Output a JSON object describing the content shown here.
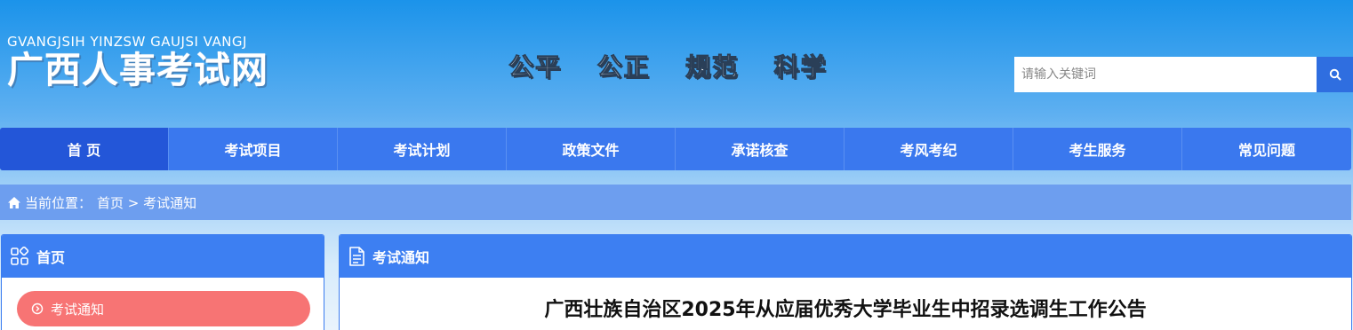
{
  "header": {
    "logo_pinyin": "GVANGJSIH YINZSW GAUJSI VANGJ",
    "logo_cn": "广西人事考试网",
    "slogan": "公平  公正  规范  科学",
    "search": {
      "placeholder": "请输入关键词",
      "button_icon": "search-icon"
    }
  },
  "nav": {
    "items": [
      {
        "label": "首 页",
        "active": true
      },
      {
        "label": "考试项目"
      },
      {
        "label": "考试计划"
      },
      {
        "label": "政策文件"
      },
      {
        "label": "承诺核查"
      },
      {
        "label": "考风考纪"
      },
      {
        "label": "考生服务"
      },
      {
        "label": "常见问题"
      }
    ]
  },
  "breadcrumb": {
    "icon": "home-icon",
    "prefix": "当前位置：",
    "path": "首页 > 考试通知"
  },
  "sidebar": {
    "title": "首页",
    "title_icon": "grid-icon",
    "items": [
      {
        "label": "考试通知",
        "icon": "circle-chevron-icon",
        "active": true
      }
    ]
  },
  "main": {
    "section_title": "考试通知",
    "section_icon": "document-icon",
    "article_title": "广西壮族自治区2025年从应届优秀大学毕业生中招录选调生工作公告"
  },
  "colors": {
    "nav_bg": "#3a78ee",
    "nav_active": "#2356d8",
    "breadcrumb_bg": "#6d9eef",
    "sidebar_active": "#f77474",
    "search_button": "#2f6ee0"
  }
}
